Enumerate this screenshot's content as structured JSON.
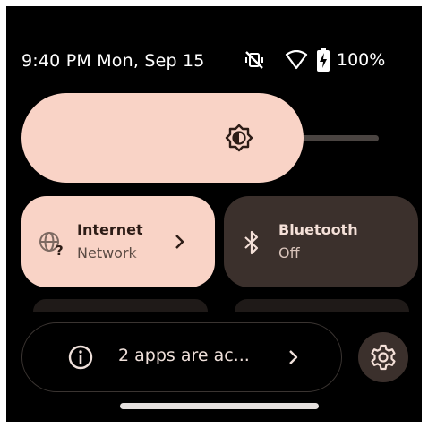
{
  "status_bar": {
    "datetime": "9:40 PM Mon, Sep 15",
    "battery": "100%",
    "icons": [
      "mute-vibrate-icon",
      "wifi-icon",
      "battery-charging-icon"
    ]
  },
  "brightness": {
    "icon": "brightness-icon",
    "level": 0.72
  },
  "tiles": {
    "internet": {
      "title": "Internet",
      "subtitle": "Network",
      "icon": "internet-unknown-icon",
      "state": "active"
    },
    "bluetooth": {
      "title": "Bluetooth",
      "subtitle": "Off",
      "icon": "bluetooth-icon",
      "state": "inactive"
    }
  },
  "footer": {
    "message": "2 apps are ac...",
    "info_icon": "info-icon",
    "settings_icon": "gear-icon"
  },
  "colors": {
    "accent": "#f9d3c6",
    "tile_inactive": "#3b302c",
    "background": "#000000"
  }
}
